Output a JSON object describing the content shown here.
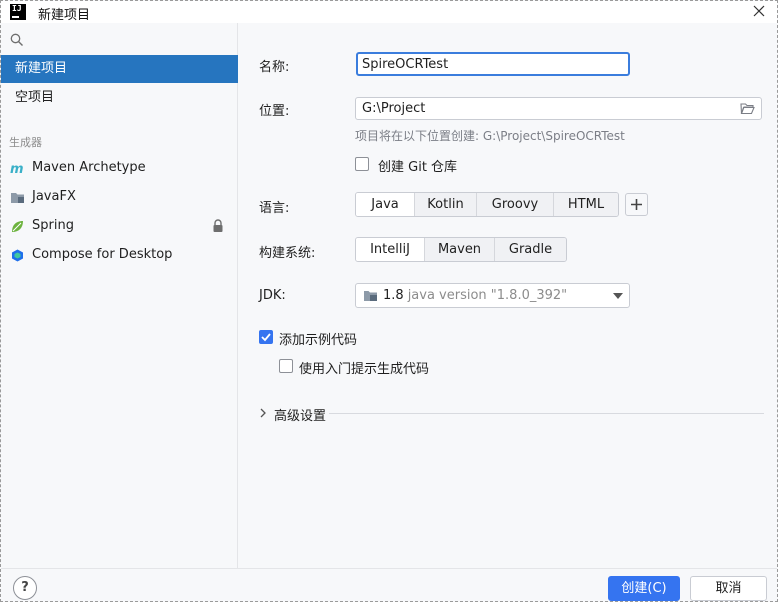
{
  "window": {
    "title": "新建项目"
  },
  "sidebar": {
    "items": [
      {
        "label": "新建项目",
        "selected": true
      },
      {
        "label": "空项目",
        "selected": false
      }
    ],
    "group_label": "生成器",
    "generators": [
      {
        "label": "Maven Archetype",
        "icon": "maven-icon"
      },
      {
        "label": "JavaFX",
        "icon": "javafx-icon"
      },
      {
        "label": "Spring",
        "icon": "spring-icon",
        "locked": true
      },
      {
        "label": "Compose for Desktop",
        "icon": "compose-icon"
      }
    ]
  },
  "form": {
    "name_label": "名称:",
    "name_value": "SpireOCRTest",
    "location_label": "位置:",
    "location_value": "G:\\Project",
    "location_hint": "项目将在以下位置创建: G:\\Project\\SpireOCRTest",
    "git_label": "创建 Git 仓库",
    "git_checked": false,
    "language_label": "语言:",
    "languages": [
      "Java",
      "Kotlin",
      "Groovy",
      "HTML"
    ],
    "language_selected": "Java",
    "build_label": "构建系统:",
    "build_systems": [
      "IntelliJ",
      "Maven",
      "Gradle"
    ],
    "build_selected": "IntelliJ",
    "jdk_label": "JDK:",
    "jdk_version": "1.8",
    "jdk_description": "java version \"1.8.0_392\"",
    "sample_code_label": "添加示例代码",
    "sample_code_checked": true,
    "onboarding_label": "使用入门提示生成代码",
    "onboarding_checked": false,
    "advanced_label": "高级设置"
  },
  "footer": {
    "help_label": "?",
    "create_label": "创建(C)",
    "cancel_label": "取消"
  },
  "colors": {
    "accent": "#3574f0",
    "selection": "#2675bf",
    "background": "#f7f8fa"
  }
}
